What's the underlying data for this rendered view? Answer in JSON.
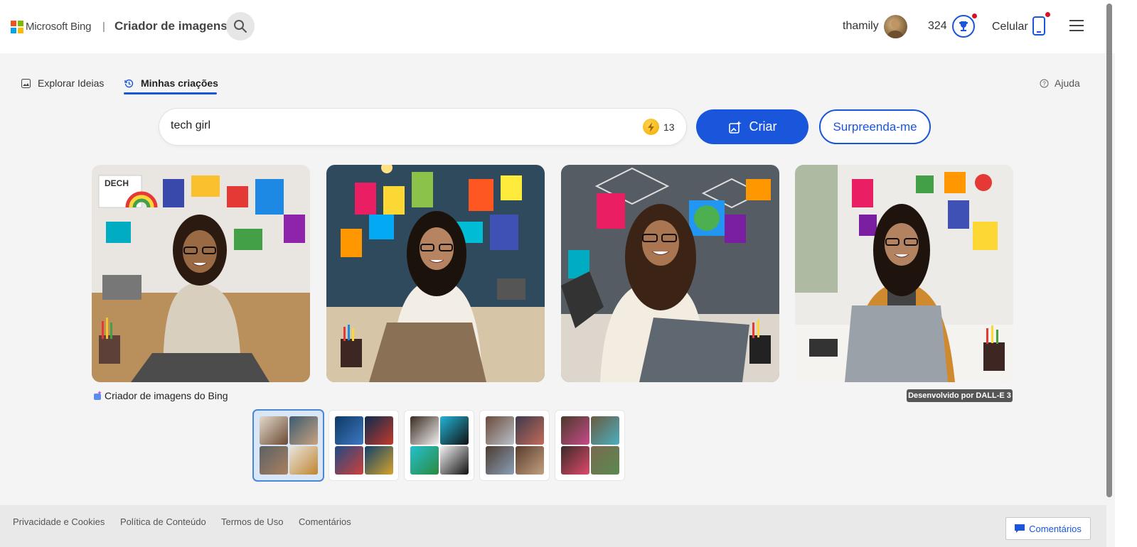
{
  "header": {
    "brand": "Microsoft Bing",
    "separator": "|",
    "title": "Criador de imagens",
    "search_icon": "search-icon",
    "username": "thamily",
    "points": "324",
    "rewards_icon": "trophy-icon",
    "mobile_label": "Celular",
    "mobile_icon": "phone-icon",
    "menu_icon": "hamburger-icon"
  },
  "tabs": {
    "explore": "Explorar Ideias",
    "mine": "Minhas criações",
    "active": "mine"
  },
  "help": "Ajuda",
  "prompt": {
    "value": "tech girl",
    "boosts": "13"
  },
  "buttons": {
    "create": "Criar",
    "surprise": "Surpreenda-me"
  },
  "images": [
    {
      "subject": "tech girl 1"
    },
    {
      "subject": "tech girl 2"
    },
    {
      "subject": "tech girl 3"
    },
    {
      "subject": "tech girl 4"
    }
  ],
  "caption": "Criador de imagens do Bing",
  "powered_by": "Desenvolvido por DALL-E 3",
  "footer": {
    "privacy": "Privacidade e Cookies",
    "content_policy": "Política de Conteúdo",
    "terms": "Termos de Uso",
    "comments": "Comentários",
    "feedback_button": "Comentários"
  },
  "colors": {
    "accent": "#1a56db",
    "background": "#f4f4f4"
  }
}
